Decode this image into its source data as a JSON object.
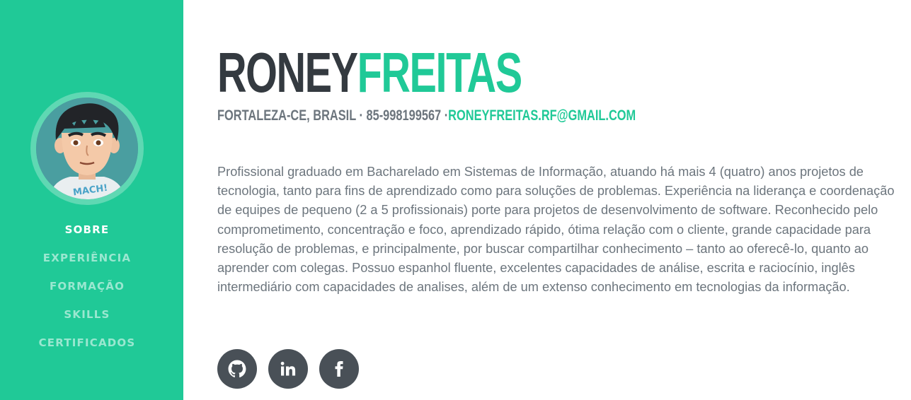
{
  "sidebar": {
    "nav": [
      {
        "label": "SOBRE",
        "active": true
      },
      {
        "label": "EXPERIÊNCIA",
        "active": false
      },
      {
        "label": "FORMAÇÃO",
        "active": false
      },
      {
        "label": "SKILLS",
        "active": false
      },
      {
        "label": "CERTIFICADOS",
        "active": false
      }
    ]
  },
  "header": {
    "first_name": "RONEY",
    "last_name": "FREITAS",
    "location_phone": "FORTALEZA-CE, BRASIL · 85-998199567 ·",
    "email": "RONEYFREITAS.RF@GMAIL.COM"
  },
  "about": {
    "text": "Profissional graduado em Bacharelado em Sistemas de Informação, atuando há mais 4 (quatro) anos projetos de tecnologia, tanto para fins de aprendizado como para soluções de problemas. Experiência na liderança e coordenação de equipes de pequeno (2 a 5 profissionais) porte para projetos de desenvolvimento de software. Reconhecido pelo comprometimento, concentração e foco, aprendizado rápido, ótima relação com o cliente, grande capacidade para resolução de problemas, e principalmente, por buscar compartilhar conhecimento – tanto ao oferecê-lo, quanto ao aprender com colegas. Possuo espanhol fluente, excelentes capacidades de análise, escrita e raciocínio, inglês intermediário com capacidades de analises, além de um extenso conhecimento em tecnologias da informação."
  },
  "social": [
    {
      "icon": "github-icon"
    },
    {
      "icon": "linkedin-icon"
    },
    {
      "icon": "facebook-icon"
    }
  ],
  "avatar": {
    "shirt_text": "MACH!"
  },
  "colors": {
    "primary": "#20c997",
    "dark": "#343a40",
    "muted": "#6c757d",
    "social_bg": "#495057"
  }
}
